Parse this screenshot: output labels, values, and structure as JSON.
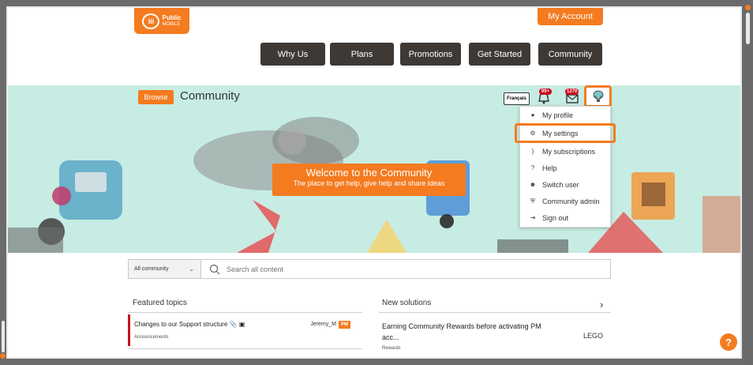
{
  "header": {
    "logo_text_1": "Public",
    "logo_text_2": "MOBILE",
    "account_button": "My Account",
    "nav": [
      "Why Us",
      "Plans",
      "Promotions",
      "Get Started",
      "Community"
    ]
  },
  "banner": {
    "browse_label": "Browse",
    "breadcrumb": "Community",
    "language_button": "Français",
    "notifications_count": "99+",
    "messages_count": "1270",
    "welcome_title": "Welcome to the Community",
    "welcome_subtitle": "The place to get help, give help and share ideas"
  },
  "user_menu": {
    "items": [
      {
        "label": "My profile",
        "icon": "user-icon"
      },
      {
        "label": "My settings",
        "icon": "gear-icon"
      },
      {
        "label": "My subscriptions",
        "icon": "rss-icon"
      },
      {
        "label": "Help",
        "icon": "question-icon"
      },
      {
        "label": "Switch user",
        "icon": "switch-user-icon"
      },
      {
        "label": "Community admin",
        "icon": "shield-icon"
      },
      {
        "label": "Sign out",
        "icon": "sign-out-icon"
      }
    ],
    "selected_index": 1
  },
  "search": {
    "scope": "All community",
    "placeholder": "Search all content"
  },
  "featured": {
    "title": "Featured topics",
    "topic_title": "Changes to our Support structure",
    "topic_category": "Announcements",
    "topic_author": "Jeremy_M",
    "author_badge": "PM"
  },
  "solutions": {
    "title": "New solutions",
    "more": "›",
    "solution_title_1": "Earning Community Rewards before activating PM",
    "solution_title_2": "acc...",
    "solution_category": "Rewards",
    "solution_author": "LEGO"
  },
  "help_button": "?",
  "colors": {
    "brand_orange": "#f47b20",
    "nav_dark": "#3f3935",
    "banner_mint": "#c7ece3",
    "alert_red": "#c4121c"
  }
}
